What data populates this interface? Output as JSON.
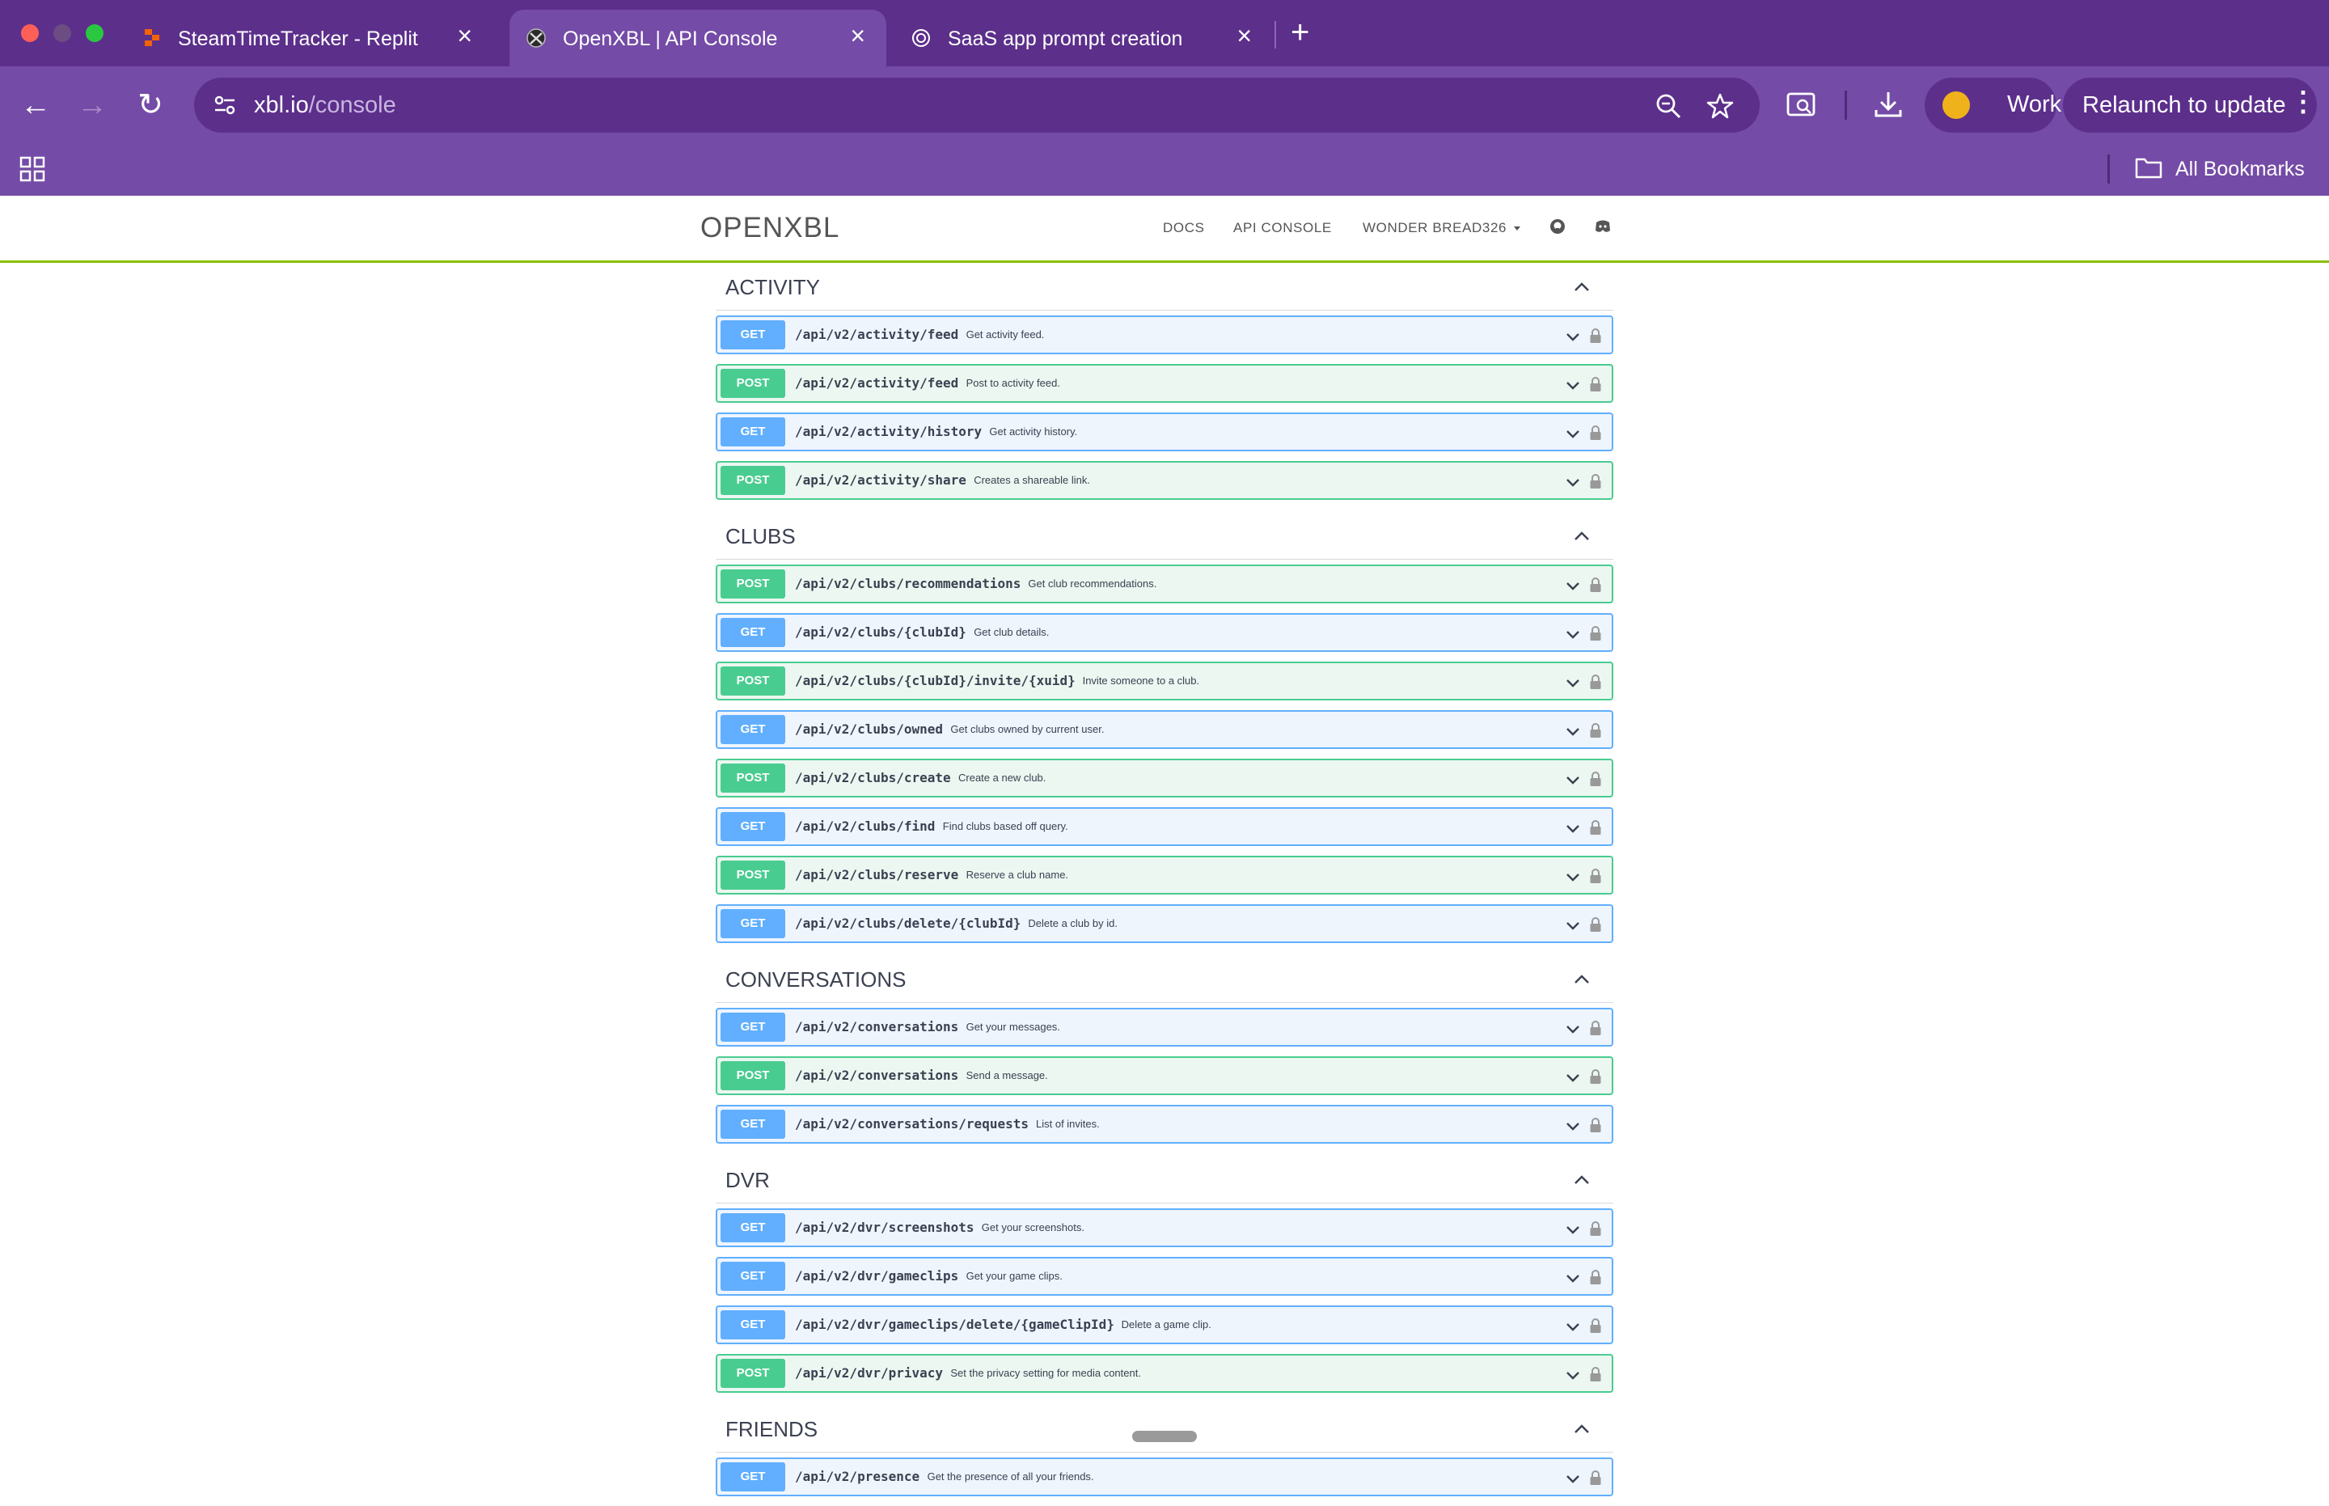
{
  "browser": {
    "tabs": [
      {
        "title": "SteamTimeTracker - Replit",
        "icon": "replit-icon",
        "active": false
      },
      {
        "title": "OpenXBL | API Console",
        "icon": "xbox-icon",
        "active": true
      },
      {
        "title": "SaaS app prompt creation",
        "icon": "openai-icon",
        "active": false
      }
    ],
    "new_tab": "+",
    "close_glyph": "×",
    "url_domain": "xbl.io",
    "url_path": "/console",
    "profile_label": "Work",
    "relaunch_label": "Relaunch to update",
    "menu_glyph": "⋮",
    "all_bookmarks": "All Bookmarks",
    "nav": {
      "back": "←",
      "forward": "→",
      "reload": "↻"
    },
    "colors": {
      "frame": "#5c2f8b",
      "toolbar": "#744ba6"
    }
  },
  "site": {
    "logo": "OPENXBL",
    "nav": {
      "docs": "DOCS",
      "console": "API CONSOLE",
      "user": "WONDER BREAD326"
    },
    "accent": "#89bf04"
  },
  "sections": [
    {
      "title": "ACTIVITY",
      "ops": [
        {
          "method": "GET",
          "path": "/api/v2/activity/feed",
          "desc": "Get activity feed."
        },
        {
          "method": "POST",
          "path": "/api/v2/activity/feed",
          "desc": "Post to activity feed."
        },
        {
          "method": "GET",
          "path": "/api/v2/activity/history",
          "desc": "Get activity history."
        },
        {
          "method": "POST",
          "path": "/api/v2/activity/share",
          "desc": "Creates a shareable link."
        }
      ]
    },
    {
      "title": "CLUBS",
      "ops": [
        {
          "method": "POST",
          "path": "/api/v2/clubs/recommendations",
          "desc": "Get club recommendations."
        },
        {
          "method": "GET",
          "path": "/api/v2/clubs/{clubId}",
          "desc": "Get club details."
        },
        {
          "method": "POST",
          "path": "/api/v2/clubs/{clubId}/invite/{xuid}",
          "desc": "Invite someone to a club."
        },
        {
          "method": "GET",
          "path": "/api/v2/clubs/owned",
          "desc": "Get clubs owned by current user."
        },
        {
          "method": "POST",
          "path": "/api/v2/clubs/create",
          "desc": "Create a new club."
        },
        {
          "method": "GET",
          "path": "/api/v2/clubs/find",
          "desc": "Find clubs based off query."
        },
        {
          "method": "POST",
          "path": "/api/v2/clubs/reserve",
          "desc": "Reserve a club name."
        },
        {
          "method": "GET",
          "path": "/api/v2/clubs/delete/{clubId}",
          "desc": "Delete a club by id."
        }
      ]
    },
    {
      "title": "CONVERSATIONS",
      "ops": [
        {
          "method": "GET",
          "path": "/api/v2/conversations",
          "desc": "Get your messages."
        },
        {
          "method": "POST",
          "path": "/api/v2/conversations",
          "desc": "Send a message."
        },
        {
          "method": "GET",
          "path": "/api/v2/conversations/requests",
          "desc": "List of invites."
        }
      ]
    },
    {
      "title": "DVR",
      "ops": [
        {
          "method": "GET",
          "path": "/api/v2/dvr/screenshots",
          "desc": "Get your screenshots."
        },
        {
          "method": "GET",
          "path": "/api/v2/dvr/gameclips",
          "desc": "Get your game clips."
        },
        {
          "method": "GET",
          "path": "/api/v2/dvr/gameclips/delete/{gameClipId}",
          "desc": "Delete a game clip."
        },
        {
          "method": "POST",
          "path": "/api/v2/dvr/privacy",
          "desc": "Set the privacy setting for media content."
        }
      ]
    },
    {
      "title": "FRIENDS",
      "ops": [
        {
          "method": "GET",
          "path": "/api/v2/presence",
          "desc": "Get the presence of all your friends."
        }
      ]
    }
  ]
}
